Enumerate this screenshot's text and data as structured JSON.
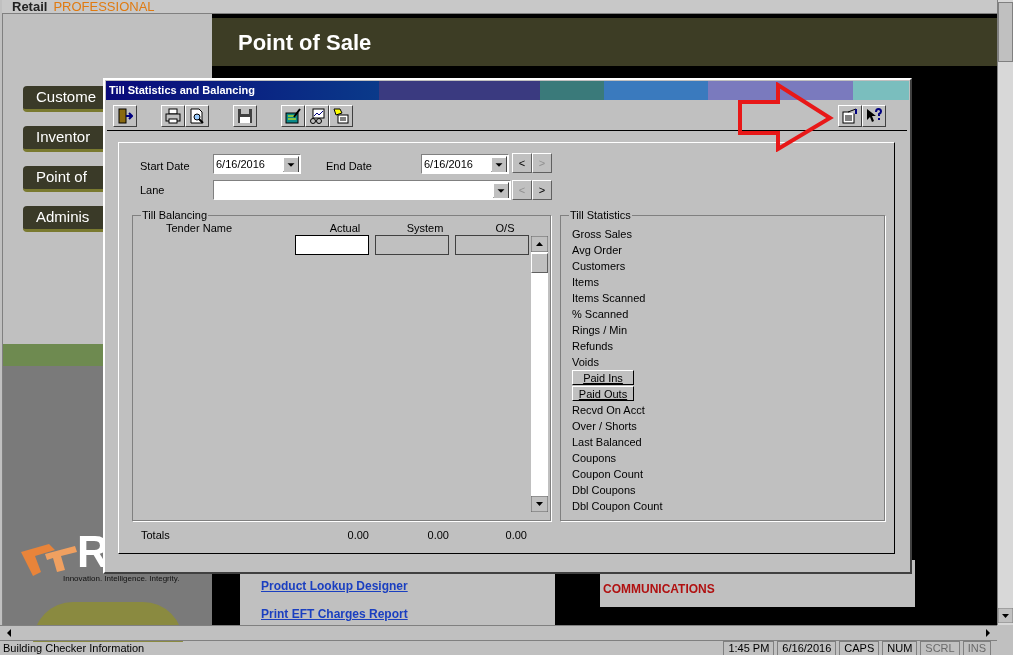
{
  "app": {
    "brand": "Retail",
    "brand_sub": "PROFESSIONAL",
    "banner_title": "Point of Sale",
    "nav_buttons": [
      "Custome",
      "Inventor",
      "Point of",
      "Adminis"
    ],
    "logo_letter": "R",
    "tagline": "Innovation. Intelligence. Integrity.",
    "links": [
      "Product Lookup Designer",
      "Print EFT Charges Report"
    ],
    "communications": "COMMUNICATIONS"
  },
  "dialog": {
    "title": "Till Statistics and Balancing",
    "start_date_label": "Start Date",
    "start_date": "6/16/2016",
    "end_date_label": "End Date",
    "end_date": "6/16/2016",
    "lane_label": "Lane",
    "date_nav": [
      {
        "text": "<",
        "disabled": false
      },
      {
        "text": ">",
        "disabled": true
      }
    ],
    "lane_nav": [
      {
        "text": "<",
        "disabled": true
      },
      {
        "text": ">",
        "disabled": false
      }
    ],
    "till_balancing": {
      "title": "Till Balancing",
      "columns": [
        "Tender Name",
        "Actual",
        "System",
        "O/S"
      ]
    },
    "till_statistics": {
      "title": "Till Statistics",
      "items": [
        {
          "kind": "label",
          "text": "Gross Sales"
        },
        {
          "kind": "label",
          "text": "Avg Order"
        },
        {
          "kind": "label",
          "text": "Customers"
        },
        {
          "kind": "label",
          "text": "Items"
        },
        {
          "kind": "label",
          "text": "Items Scanned"
        },
        {
          "kind": "label",
          "text": "% Scanned"
        },
        {
          "kind": "label",
          "text": "Rings / Min"
        },
        {
          "kind": "label",
          "text": "Refunds"
        },
        {
          "kind": "label",
          "text": "Voids"
        },
        {
          "kind": "button",
          "text": "Paid Ins"
        },
        {
          "kind": "button",
          "text": "Paid Outs"
        },
        {
          "kind": "label",
          "text": "Recvd On Acct"
        },
        {
          "kind": "label",
          "text": "Over / Shorts"
        },
        {
          "kind": "label",
          "text": "Last Balanced"
        },
        {
          "kind": "label",
          "text": "Coupons"
        },
        {
          "kind": "label",
          "text": "Coupon Count"
        },
        {
          "kind": "label",
          "text": "Dbl Coupons"
        },
        {
          "kind": "label",
          "text": "Dbl Coupon Count"
        }
      ]
    },
    "totals": {
      "label": "Totals",
      "values": [
        "0.00",
        "0.00",
        "0.00"
      ]
    }
  },
  "status_bar": {
    "message": "Building Checker Information",
    "panels": [
      {
        "text": "1:45 PM",
        "disabled": false
      },
      {
        "text": "6/16/2016",
        "disabled": false
      },
      {
        "text": "CAPS",
        "disabled": false
      },
      {
        "text": "NUM",
        "disabled": false
      },
      {
        "text": "SCRL",
        "disabled": true
      },
      {
        "text": "INS",
        "disabled": true
      }
    ]
  }
}
